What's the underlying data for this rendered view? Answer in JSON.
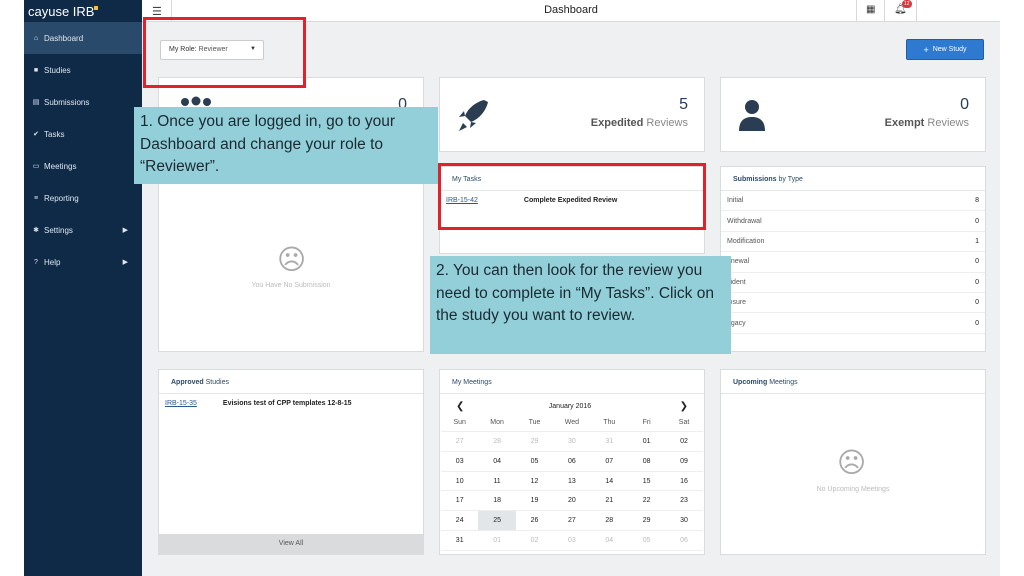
{
  "app": {
    "brand": "cayuse IRB",
    "page_title": "Dashboard",
    "notification_count": "12"
  },
  "sidebar": {
    "items": [
      {
        "label": "Dashboard",
        "icon": "home-icon",
        "glyph": "⌂",
        "active": true
      },
      {
        "label": "Studies",
        "icon": "folder-icon",
        "glyph": "■"
      },
      {
        "label": "Submissions",
        "icon": "file-icon",
        "glyph": "▤"
      },
      {
        "label": "Tasks",
        "icon": "check-icon",
        "glyph": "✔"
      },
      {
        "label": "Meetings",
        "icon": "calendar-icon",
        "glyph": "▭"
      },
      {
        "label": "Reporting",
        "icon": "list-icon",
        "glyph": "≡"
      },
      {
        "label": "Settings",
        "icon": "gear-icon",
        "glyph": "✱",
        "has_caret": true
      },
      {
        "label": "Help",
        "icon": "question-icon",
        "glyph": "?",
        "has_caret": true
      }
    ]
  },
  "toolbar": {
    "role_prefix": "My Role:",
    "role_value": "Reviewer",
    "new_study_label": "New Study"
  },
  "stats": {
    "first": {
      "value": "0"
    },
    "expedited": {
      "value": "5",
      "label_bold": "Expedited",
      "label_rest": "Reviews"
    },
    "exempt": {
      "value": "0",
      "label_bold": "Exempt",
      "label_rest": "Reviews"
    }
  },
  "my_submissions": {
    "empty_text": "You Have No Submission"
  },
  "my_tasks": {
    "title_bold": "My",
    "title_rest": "Tasks",
    "rows": [
      {
        "id": "IRB-15-42",
        "desc": "Complete Expedited Review"
      }
    ]
  },
  "submissions_by_type": {
    "title_bold": "Submissions",
    "title_rest": "by Type",
    "rows": [
      {
        "type": "Initial",
        "count": "8"
      },
      {
        "type": "Withdrawal",
        "count": "0"
      },
      {
        "type": "Modification",
        "count": "1"
      },
      {
        "type": "enewal",
        "count": "0"
      },
      {
        "type": "cident",
        "count": "0"
      },
      {
        "type": "losure",
        "count": "0"
      },
      {
        "type": "egacy",
        "count": "0"
      }
    ]
  },
  "approved_studies": {
    "title_bold": "Approved",
    "title_rest": "Studies",
    "rows": [
      {
        "id": "IRB-15-35",
        "desc": "Evisions test of CPP templates 12-8-15"
      }
    ],
    "view_all": "View All"
  },
  "my_meetings": {
    "title_bold": "My",
    "title_rest": "Meetings",
    "month": "January 2016",
    "weekdays": [
      "Sun",
      "Mon",
      "Tue",
      "Wed",
      "Thu",
      "Fri",
      "Sat"
    ],
    "weeks": [
      [
        "27",
        "28",
        "29",
        "30",
        "31",
        "01",
        "02"
      ],
      [
        "03",
        "04",
        "05",
        "06",
        "07",
        "08",
        "09"
      ],
      [
        "10",
        "11",
        "12",
        "13",
        "14",
        "15",
        "16"
      ],
      [
        "17",
        "18",
        "19",
        "20",
        "21",
        "22",
        "23"
      ],
      [
        "24",
        "25",
        "26",
        "27",
        "28",
        "29",
        "30"
      ],
      [
        "31",
        "01",
        "02",
        "03",
        "04",
        "05",
        "06"
      ]
    ]
  },
  "upcoming_meetings": {
    "title_bold": "Upcoming",
    "title_rest": "Meetings",
    "empty_text": "No Upcoming Meetings"
  },
  "callouts": {
    "one": "1. Once you are logged in, go to your Dashboard and change your role to “Reviewer”.",
    "two": "2. You can then look for the review you need to complete in “My Tasks”. Click on the study you want to review."
  },
  "colors": {
    "sidebar": "#0e2a47",
    "accent": "#2e7ad1",
    "highlight": "#e3212b",
    "callout": "#92cfd8"
  }
}
